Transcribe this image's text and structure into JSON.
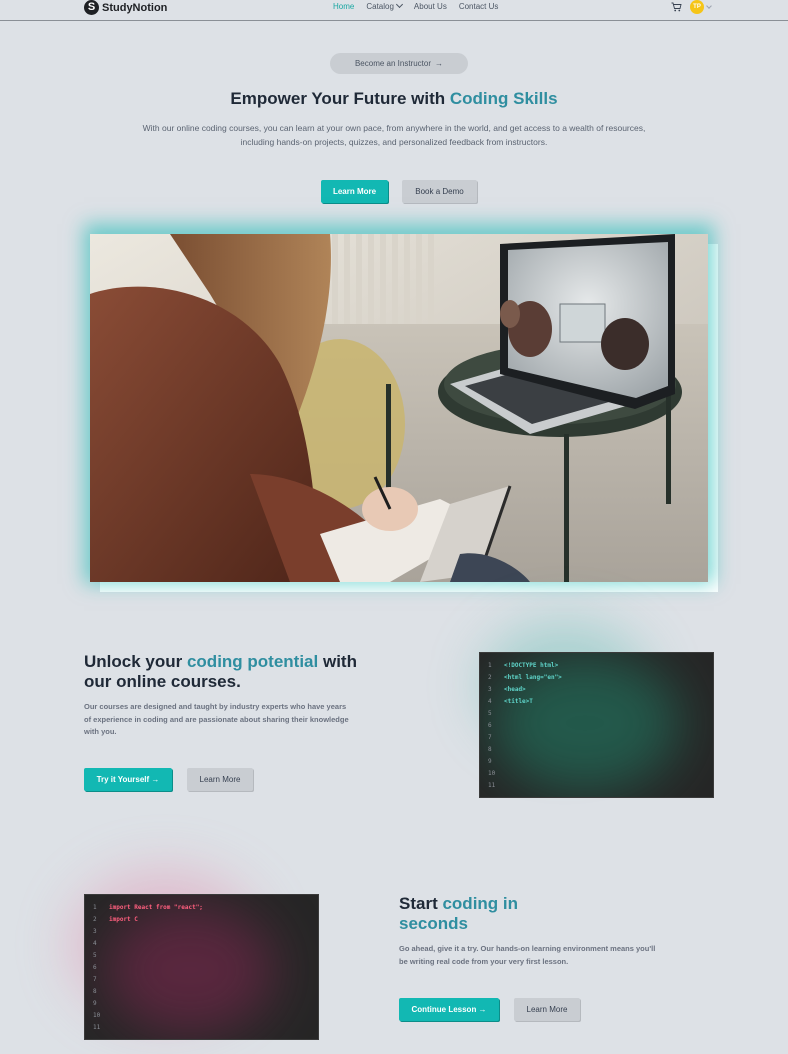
{
  "nav": {
    "brand": "StudyNotion",
    "brand_mark": "S",
    "links": [
      "Home",
      "Catalog",
      "About Us",
      "Contact Us"
    ],
    "avatar_initials": "TP",
    "cart_icon": "cart-icon"
  },
  "hero": {
    "pill_label": "Become an Instructor",
    "title_prefix": "Empower Your Future with ",
    "title_highlight": "Coding Skills",
    "subtitle": "With our online coding courses, you can learn at your own pace, from anywhere in the world, and get access to a wealth of resources, including hands-on projects, quizzes, and personalized feedback from instructors.",
    "primary_button": "Learn More",
    "secondary_button": "Book a Demo"
  },
  "section1": {
    "title_prefix": "Unlock your ",
    "title_highlight": "coding potential",
    "title_suffix": " with our online courses.",
    "description": "Our courses are designed and taught by industry experts who have years of experience in coding and are passionate about sharing their knowledge with you.",
    "primary_button": "Try it Yourself",
    "secondary_button": "Learn More",
    "line_numbers": [
      "1",
      "2",
      "3",
      "4",
      "5",
      "6",
      "7",
      "8",
      "9",
      "10",
      "11"
    ],
    "code": [
      "<!DOCTYPE html>",
      "<html lang=\"en\">",
      "<head>",
      "<title>T"
    ],
    "code_color": "#5fd4c9"
  },
  "section2": {
    "title_prefix": "Start ",
    "title_highlight": "coding in seconds",
    "description": "Go ahead, give it a try. Our hands-on learning environment means you'll be writing real code from your very first lesson.",
    "primary_button": "Continue Lesson",
    "secondary_button": "Learn More",
    "line_numbers": [
      "1",
      "2",
      "3",
      "4",
      "5",
      "6",
      "7",
      "8",
      "9",
      "10",
      "11"
    ],
    "code": [
      "import React from \"react\";",
      "import C"
    ],
    "code_color": "#ff5f7e"
  },
  "colors": {
    "accent": "#12b8b3",
    "highlight_text": "#2f8ea0",
    "background": "#dde1e6"
  }
}
